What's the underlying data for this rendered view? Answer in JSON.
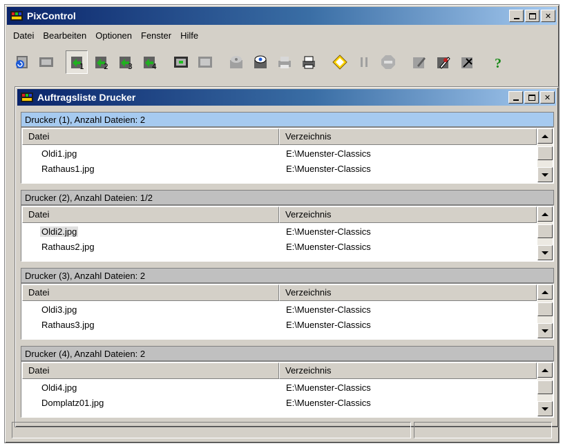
{
  "window": {
    "title": "PixControl",
    "title_gradient": [
      "#0a246a",
      "#a6caf0"
    ]
  },
  "menu": [
    "Datei",
    "Bearbeiten",
    "Optionen",
    "Fenster",
    "Hilfe"
  ],
  "toolbar": {
    "icons": [
      "refresh-film-icon",
      "film-strip-icon",
      "printer-1-icon",
      "printer-2-icon",
      "printer-3-icon",
      "printer-4-icon",
      "frame-green-icon",
      "frame-gray-icon",
      "preview-icon",
      "eye-preview-icon",
      "print-icon",
      "print-queue-icon",
      "start-icon",
      "pause-icon",
      "stop-icon",
      "edit-icon",
      "tools-icon",
      "settings-icon",
      "help-icon"
    ],
    "digits": [
      "1",
      "2",
      "3",
      "4"
    ],
    "help_label": "?"
  },
  "child": {
    "title": "Auftragsliste Drucker"
  },
  "columns": {
    "file": "Datei",
    "dir": "Verzeichnis"
  },
  "groups": [
    {
      "header": "Drucker (1), Anzahl Dateien: 2",
      "active": true,
      "rows": [
        {
          "file": "Oldi1.jpg",
          "dir": "E:\\Muenster-Classics"
        },
        {
          "file": "Rathaus1.jpg",
          "dir": "E:\\Muenster-Classics"
        }
      ]
    },
    {
      "header": "Drucker (2), Anzahl Dateien: 1/2",
      "active": false,
      "rows": [
        {
          "file": "Oldi2.jpg",
          "dir": "E:\\Muenster-Classics"
        },
        {
          "file": "Rathaus2.jpg",
          "dir": "E:\\Muenster-Classics"
        }
      ]
    },
    {
      "header": "Drucker (3), Anzahl Dateien: 2",
      "active": false,
      "rows": [
        {
          "file": "Oldi3.jpg",
          "dir": "E:\\Muenster-Classics"
        },
        {
          "file": "Rathaus3.jpg",
          "dir": "E:\\Muenster-Classics"
        }
      ]
    },
    {
      "header": "Drucker (4), Anzahl Dateien: 2",
      "active": false,
      "rows": [
        {
          "file": "Oldi4.jpg",
          "dir": "E:\\Muenster-Classics"
        },
        {
          "file": "Domplatz01.jpg",
          "dir": "E:\\Muenster-Classics"
        }
      ]
    }
  ]
}
